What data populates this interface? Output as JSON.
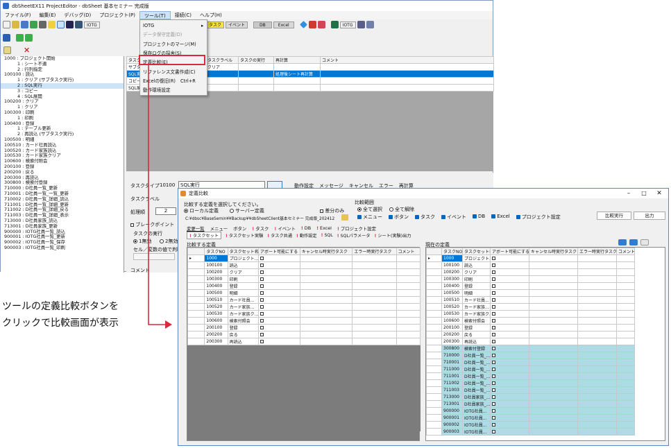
{
  "main_window": {
    "title": "dbSheetEX11 ProjectEditor - dbSheet 基本セミナー 完成版",
    "menu": [
      "ファイル(F)",
      "編集(E)",
      "デバッグ(D)",
      "プロジェクト(P)",
      "ツール(T)",
      "接続(C)",
      "ヘルプ(H)"
    ],
    "toolbar_labels": {
      "iotg": "IOTG",
      "task": "タスク",
      "event": "イベント",
      "db": "DB",
      "excel": "Excel",
      "iotg2": "IOTG"
    },
    "tree": [
      "1000 : プロジェクト開始",
      "1 : シート不適",
      "2 : 行列指定",
      "100100 : 読込",
      "1 : クリア (サブタスク実行)",
      "2 : SQL実行",
      "3 : コピー",
      "4 : SQL展開",
      "100200 : クリア",
      "1 : クリア",
      "100300 : 印刷",
      "1 : 印刷",
      "100400 : 登録",
      "1 : テーブル更新",
      "2 : 再読込 (サブタスク実行)",
      "100500 : 明細",
      "100510 : カード社員読込",
      "100520 : カード家族読込",
      "100530 : カード家族クリア",
      "100600 : 検索付照会",
      "200100 : 登録",
      "200200 : 戻る",
      "200300 : 再読込",
      "300800 : 検索付登録",
      "710000 : D社員一覧_更新",
      "710001 : D社員一覧_一覧_更新",
      "710002 : D社員一覧_詳細_読込",
      "711001 : D社員一覧_詳細_更新",
      "711002 : D社員一覧_詳細_戻る",
      "711003 : D社員一覧_詳細_表示",
      "713000 : D社員家族_読込",
      "713001 : D社員家族_更新",
      "900000 : IOTG社員一覧_読込",
      "900001 : IOTG社員一覧_更新",
      "900002 : IOTG社員一覧_保存",
      "900003 : IOTG社員一覧_印刷"
    ],
    "grid_headers": [
      "タスクタイプ",
      "タスクラベル",
      "タスクの実行",
      "再計算",
      "コメント"
    ],
    "grid_rows": [
      [
        "サブタスク実行",
        "クリア",
        "",
        "",
        ""
      ],
      [
        "SQL実行",
        "",
        "",
        "処理後シート再計算",
        ""
      ],
      [
        "コピー",
        "",
        "",
        "",
        ""
      ],
      [
        "SQL展開",
        "",
        "",
        "",
        ""
      ]
    ],
    "bottom": {
      "task_type_label": "タスクタイプ",
      "task_type_code": "10100",
      "task_type_value": "SQL実行",
      "task_label": "タスクラベル",
      "order_label": "処理順",
      "order_value": "2",
      "breakpoint": "ブレークポイント",
      "exec_label": "タスクの実行",
      "opt1": "1無効",
      "opt2": "2無効",
      "cell_label": "セル／変数の値で判断",
      "comment": "コメント",
      "tabs": [
        "動作設定",
        "メッセージ",
        "キャンセル",
        "エラー",
        "再計算"
      ]
    }
  },
  "tool_menu": {
    "items": [
      {
        "label": "IOTG",
        "dis": false,
        "arrow": true
      },
      {
        "label": "データ保守定義(D)",
        "dis": true
      },
      {
        "label": "プロジェクトのマージ(M)",
        "dis": false
      },
      {
        "label": "保存ログの採舍(S)",
        "dis": false
      },
      {
        "label": "定義比較(E)",
        "dis": false,
        "highlight": true
      },
      {
        "label": "リファレンス文書作成(C)",
        "dis": false
      },
      {
        "label": "Excelの復旧(R)",
        "dis": false,
        "shortcut": "Ctrl+R"
      },
      {
        "label": "動作環境設定",
        "dis": false
      }
    ]
  },
  "annotation": {
    "line1": "ツールの定義比較ボタンを",
    "line2": "クリックで比較画面が表示"
  },
  "compare_window": {
    "title": "定義比較",
    "target_group": "比較する定義を選択してください。",
    "local": "ローカル定義",
    "server": "サーバー定義",
    "diff_only": "差分のみ",
    "path": "C:¥dbsc¥BaseSemin¥¥Backup¥¥dbSheetClient基本セミナー 完成版_202412",
    "range_label": "比較範囲",
    "select_all": "全て選択",
    "clear_all": "全て解除",
    "checks": [
      "メニュー",
      "ボタン",
      "タスク",
      "イベント",
      "DB",
      "Excel",
      "プロジェクト設定"
    ],
    "compare_btn": "比較実行",
    "exit_btn": "出力",
    "tabs": [
      "変更一覧",
      "メニュー",
      "ボタン",
      "タスク",
      "イベント",
      "DB",
      "Excel",
      "プロジェクト設定"
    ],
    "subtabs": [
      "タスクセット",
      "タスクセット実験",
      "タスク共通",
      "動作設定",
      "SQL",
      "SQLパラメータ",
      "シート(実験)出力"
    ],
    "left_title": "比較する定義",
    "right_title": "現在の定義",
    "headers": [
      "タスクNO",
      "タスクセット名",
      "アボート可能にする",
      "キャンセル時実行タスク",
      "エラー時実行タスク",
      "コメント"
    ],
    "left_rows": [
      [
        "1000",
        "プロジェクト..."
      ],
      [
        "100100",
        "読込"
      ],
      [
        "100200",
        "クリア"
      ],
      [
        "100300",
        "印刷"
      ],
      [
        "100400",
        "登録"
      ],
      [
        "100500",
        "明細"
      ],
      [
        "100510",
        "カード社員..."
      ],
      [
        "100520",
        "カード家族..."
      ],
      [
        "100530",
        "カード家族ク..."
      ],
      [
        "100600",
        "検索付照会"
      ],
      [
        "200100",
        "登録"
      ],
      [
        "200200",
        "戻る"
      ],
      [
        "200300",
        "再読込"
      ]
    ],
    "right_rows": [
      [
        "1000",
        "プロジェクト..."
      ],
      [
        "100100",
        "読込"
      ],
      [
        "100200",
        "クリア"
      ],
      [
        "100300",
        "印刷"
      ],
      [
        "100400",
        "登録"
      ],
      [
        "100500",
        "明細"
      ],
      [
        "100510",
        "カード社員..."
      ],
      [
        "100520",
        "カード家族..."
      ],
      [
        "100530",
        "カード家族ク..."
      ],
      [
        "100600",
        "検索付照会"
      ],
      [
        "200100",
        "登録"
      ],
      [
        "200200",
        "戻る"
      ],
      [
        "200300",
        "再読込"
      ],
      [
        "300800",
        "検索付登録"
      ],
      [
        "710000",
        "D社員一覧_..."
      ],
      [
        "710001",
        "D社員一覧_..."
      ],
      [
        "711000",
        "D社員一覧_..."
      ],
      [
        "711001",
        "D社員一覧_..."
      ],
      [
        "711002",
        "D社員一覧_..."
      ],
      [
        "711003",
        "D社員一覧_..."
      ],
      [
        "713000",
        "D社員家族_..."
      ],
      [
        "713001",
        "D社員家族_..."
      ],
      [
        "900000",
        "IOTG社員..."
      ],
      [
        "900001",
        "IOTG社員..."
      ],
      [
        "900002",
        "IOTG社員..."
      ],
      [
        "900003",
        "IOTG社員..."
      ]
    ]
  },
  "colors": {
    "highlight_red": "#d9293d",
    "select_blue": "#0078d7",
    "diff_blue": "#addbe6",
    "empty_gray": "#7c7c7c"
  }
}
